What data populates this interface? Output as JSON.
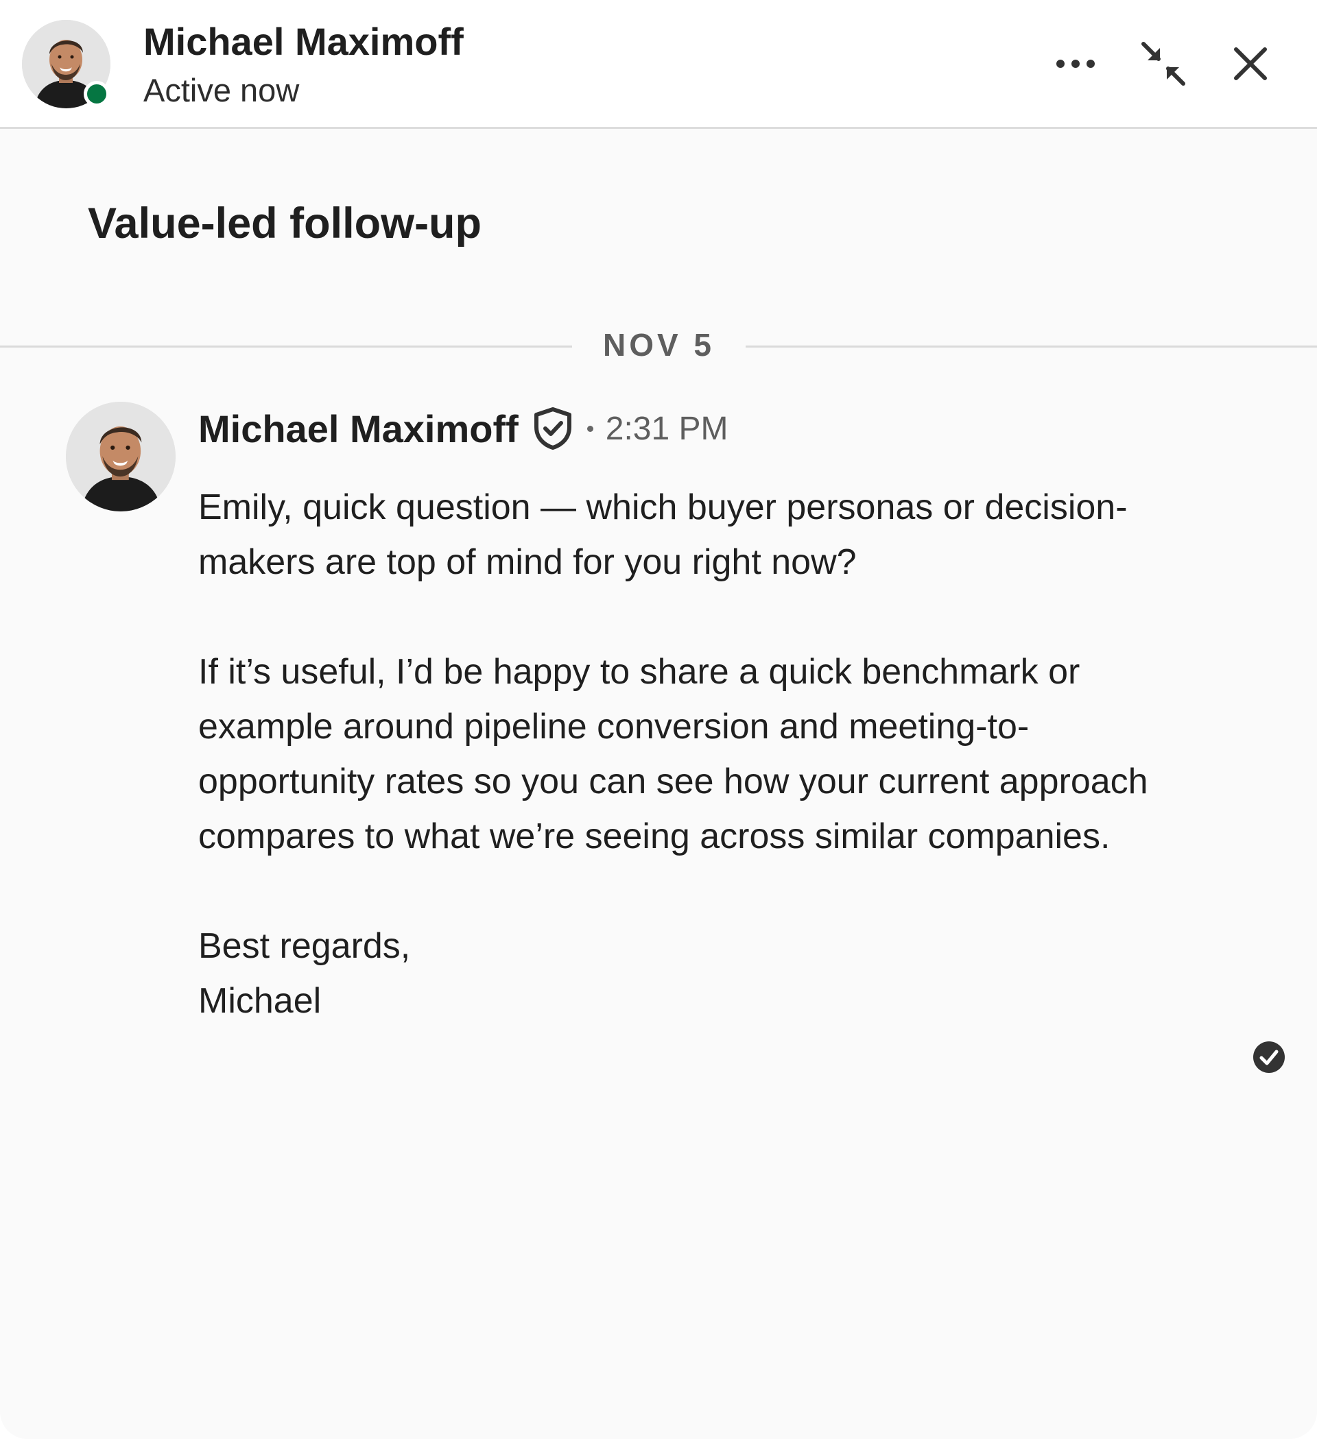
{
  "header": {
    "contact_name": "Michael Maximoff",
    "status": "Active now",
    "actions": {
      "more": "more-horizontal-icon",
      "minimize": "minimize-arrows-icon",
      "close": "close-icon"
    },
    "status_color": "#057642"
  },
  "conversation": {
    "title": "Value-led follow-up",
    "date_divider": "NOV 5",
    "messages": [
      {
        "sender": "Michael Maximoff",
        "verified_icon": "verified-shield-icon",
        "time": "2:31 PM",
        "paragraph_1": "Emily, quick question — which buyer personas or decision-makers are top of mind for you right now?",
        "paragraph_2": "If it’s useful, I’d be happy to share a quick benchmark or example around pipeline conversion and meeting-to-opportunity rates so you can see how your current approach compares to what we’re seeing across similar companies.",
        "closing": "Best regards,",
        "signature": "Michael",
        "read_receipt_icon": "check-circle-icon"
      }
    ]
  }
}
